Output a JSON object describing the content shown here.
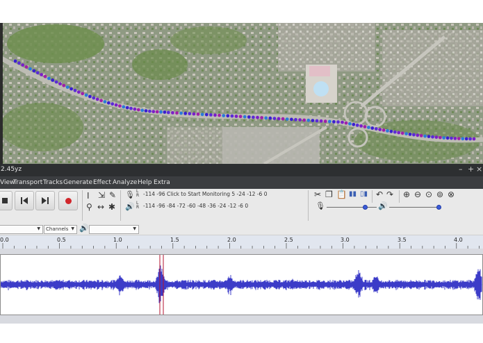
{
  "window": {
    "title": "2.45yz"
  },
  "menu": {
    "items": [
      "View",
      "Transport",
      "Tracks",
      "Generate",
      "Effect",
      "Analyze",
      "Help",
      "Extra"
    ]
  },
  "transport": {
    "stop_icon": "stop-icon",
    "skip_start_icon": "skip-to-start-icon",
    "skip_end_icon": "skip-to-end-icon",
    "record_icon": "record-icon",
    "record_color": "#d1262b"
  },
  "meters": {
    "record_meter_text": "-114     -96     Click to Start Monitoring 5     -24    -12  -6  0",
    "playback_meter_text": "-114     -96     -84     -72     -60     -48     -36     -24     -12  -6  0",
    "lr_label": "L R"
  },
  "device_row": {
    "channels_label": "Channels"
  },
  "ruler": {
    "labels": [
      "0.0",
      "0.5",
      "1.0",
      "1.5",
      "2.0",
      "2.5",
      "3.0",
      "3.5",
      "4.0"
    ]
  },
  "waveform": {
    "color": "#3c3cc8",
    "cursor_color": "#b3122e"
  },
  "map": {
    "track_colors": [
      "#3a1fd0",
      "#5b2bd6",
      "#7a1fc9",
      "#a020a8",
      "#2b7bd9",
      "#1fbf8f"
    ]
  }
}
